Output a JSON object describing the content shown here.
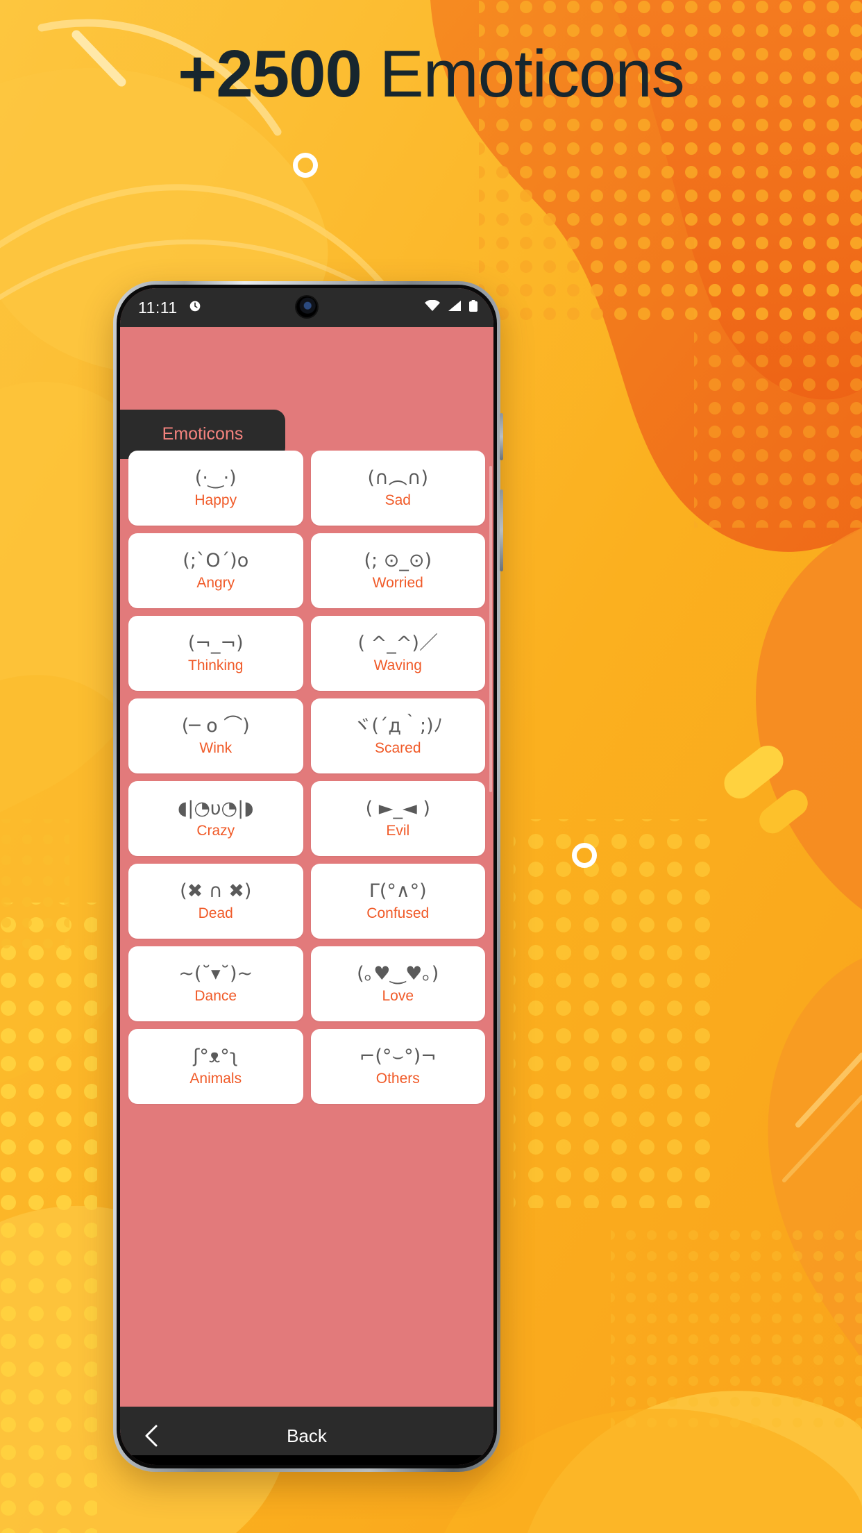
{
  "poster": {
    "headline_number": "+2500",
    "headline_word": "Emoticons",
    "headline_color": "#17262E",
    "bg_colors": {
      "yellow": "#FBB724",
      "yellow_light": "#FDC63F",
      "orange": "#F47A20",
      "orange_deep": "#EF6C1A",
      "dot_yellow": "#FFD23F",
      "ring_white": "#FFFFFF"
    }
  },
  "phone": {
    "statusbar": {
      "time": "11:11",
      "left_icons": [
        "alarm-icon"
      ],
      "right_icons": [
        "wifi-icon",
        "signal-icon",
        "battery-icon"
      ],
      "background": "#2B2B2B",
      "foreground": "#FFFFFF"
    },
    "app": {
      "background": "#E27A7B",
      "accent_label": "#F05A28",
      "tab": {
        "label": "Emoticons",
        "background": "#2B2B2B",
        "text_color": "#F4837E"
      },
      "cards": [
        {
          "face": "(·‿·)",
          "label": "Happy"
        },
        {
          "face": "(∩︵∩)",
          "label": "Sad"
        },
        {
          "face": "(;`O´)o",
          "label": "Angry"
        },
        {
          "face": "(; ⊙_⊙)",
          "label": "Worried"
        },
        {
          "face": "(¬_¬)",
          "label": "Thinking"
        },
        {
          "face": "( ^_^)／",
          "label": "Waving"
        },
        {
          "face": "(─ o ⌒)",
          "label": "Wink"
        },
        {
          "face": "ヾ(´д｀;)ﾉ",
          "label": "Scared"
        },
        {
          "face": "◖|◔υ◔|◗",
          "label": "Crazy"
        },
        {
          "face": "( ►_◄ )",
          "label": "Evil"
        },
        {
          "face": "(✖ ∩ ✖)",
          "label": "Dead"
        },
        {
          "face": "Γ(°∧°)",
          "label": "Confused"
        },
        {
          "face": "~(˘▾˘)~",
          "label": "Dance"
        },
        {
          "face": "(｡♥‿♥｡)",
          "label": "Love"
        },
        {
          "face": "ʃ°ᴥ°ʅ",
          "label": "Animals"
        },
        {
          "face": "⌐(°⌣°)¬",
          "label": "Others"
        }
      ],
      "navbar": {
        "back_icon": "chevron-left-icon",
        "back_label": "Back",
        "background": "#2B2B2B"
      }
    }
  }
}
